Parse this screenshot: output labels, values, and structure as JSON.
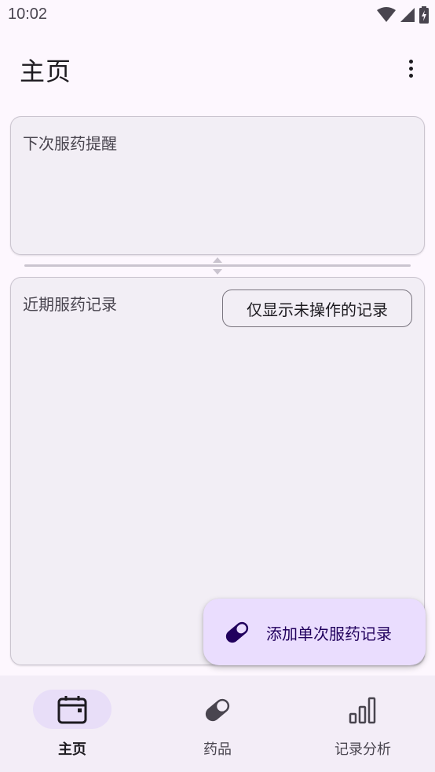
{
  "status_bar": {
    "time": "10:02"
  },
  "app_bar": {
    "title": "主页"
  },
  "reminder_card": {
    "title": "下次服药提醒"
  },
  "records_card": {
    "title": "近期服药记录",
    "filter_button": "仅显示未操作的记录"
  },
  "fab": {
    "label": "添加单次服药记录"
  },
  "bottom_nav": {
    "items": [
      {
        "label": "主页",
        "icon": "calendar-icon",
        "active": true
      },
      {
        "label": "药品",
        "icon": "pill-icon",
        "active": false
      },
      {
        "label": "记录分析",
        "icon": "bar-chart-icon",
        "active": false
      }
    ]
  },
  "colors": {
    "background": "#fdf7fe",
    "card": "#f2eef5",
    "fab": "#eaddfe",
    "nav_active_indicator": "#e8def8"
  }
}
